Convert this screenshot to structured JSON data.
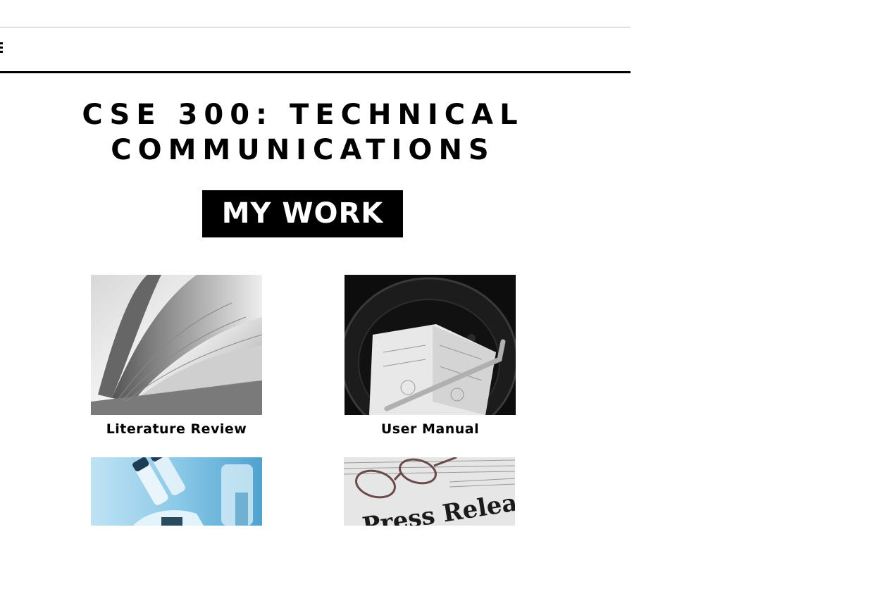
{
  "header": {
    "title": "CSE 300: TECHNICAL COMMUNICATIONS",
    "section_label": "MY WORK"
  },
  "nav": {
    "menu_icon": "hamburger-menu-icon"
  },
  "projects": [
    {
      "label": "Literature Review",
      "image": "open-book-photo"
    },
    {
      "label": "User Manual",
      "image": "manual-in-drum-photo"
    },
    {
      "label": "",
      "image": "microscope-photo"
    },
    {
      "label": "",
      "image": "press-release-newspaper-photo",
      "image_text": "Press Release"
    }
  ],
  "colors": {
    "text": "#000000",
    "background": "#ffffff",
    "label_background": "#000000",
    "label_text": "#ffffff",
    "microscope_tint": "#8cc9e8"
  }
}
